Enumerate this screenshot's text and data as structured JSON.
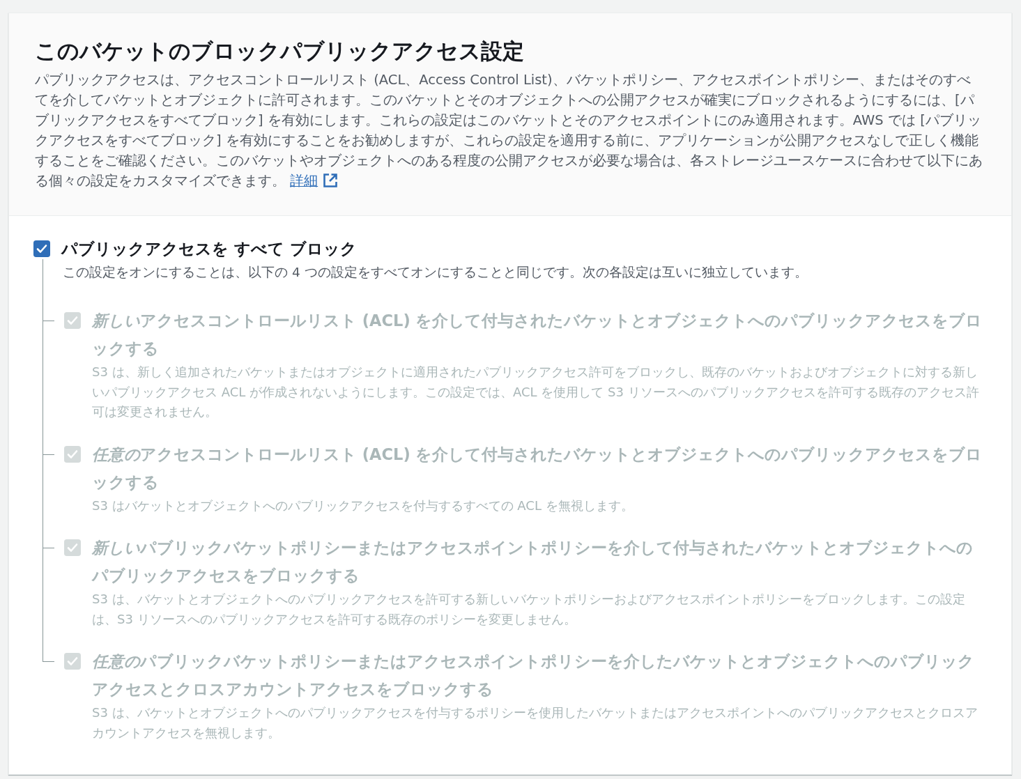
{
  "panel": {
    "title": "このバケットのブロックパブリックアクセス設定",
    "description": "パブリックアクセスは、アクセスコントロールリスト (ACL、Access Control List)、バケットポリシー、アクセスポイントポリシー、またはそのすべてを介してバケットとオブジェクトに許可されます。このバケットとそのオブジェクトへの公開アクセスが確実にブロックされるようにするには、[パブリックアクセスをすべてブロック] を有効にします。これらの設定はこのバケットとそのアクセスポイントにのみ適用されます。AWS では [パブリックアクセスをすべてブロック] を有効にすることをお勧めしますが、これらの設定を適用する前に、アプリケーションが公開アクセスなしで正しく機能することをご確認ください。このバケットやオブジェクトへのある程度の公開アクセスが必要な場合は、各ストレージユースケースに合わせて以下にある個々の設定をカスタマイズできます。",
    "link": {
      "label": "詳細"
    }
  },
  "block_all": {
    "label": "パブリックアクセスを すべて ブロック",
    "checked": true,
    "description": "この設定をオンにすることは、以下の 4 つの設定をすべてオンにすることと同じです。次の各設定は互いに独立しています。"
  },
  "options": [
    {
      "title": [
        {
          "text": "新しい",
          "italic": true
        },
        {
          "text": "アクセスコントロールリスト (ACL) を介して付与されたバケットとオブジェクトへのパブリックアクセスをブロックする",
          "italic": false
        }
      ],
      "description": "S3 は、新しく追加されたバケットまたはオブジェクトに適用されたパブリックアクセス許可をブロックし、既存のバケットおよびオブジェクトに対する新しいパブリックアクセス ACL が作成されないようにします。この設定では、ACL を使用して S3 リソースへのパブリックアクセスを許可する既存のアクセス許可は変更されません。",
      "checked": true,
      "disabled": true
    },
    {
      "title": [
        {
          "text": "任意の",
          "italic": true
        },
        {
          "text": "アクセスコントロールリスト (ACL) を介して付与されたバケットとオブジェクトへのパブリックアクセスをブロックする",
          "italic": false
        }
      ],
      "description": "S3 はバケットとオブジェクトへのパブリックアクセスを付与するすべての ACL を無視します。",
      "checked": true,
      "disabled": true
    },
    {
      "title": [
        {
          "text": "新しい",
          "italic": true
        },
        {
          "text": "パブリックバケットポリシーまたはアクセスポイントポリシーを介して付与されたバケットとオブジェクトへのパブリックアクセスをブロックする",
          "italic": false
        }
      ],
      "description": "S3 は、バケットとオブジェクトへのパブリックアクセスを許可する新しいバケットポリシーおよびアクセスポイントポリシーをブロックします。この設定は、S3 リソースへのパブリックアクセスを許可する既存のポリシーを変更しません。",
      "checked": true,
      "disabled": true
    },
    {
      "title": [
        {
          "text": "任意の",
          "italic": true
        },
        {
          "text": "パブリックバケットポリシーまたはアクセスポイントポリシーを介したバケットとオブジェクトへのパブリックアクセスとクロスアカウントアクセスをブロックする",
          "italic": false
        }
      ],
      "description": "S3 は、バケットとオブジェクトへのパブリックアクセスを付与するポリシーを使用したバケットまたはアクセスポイントへのパブリックアクセスとクロスアカウントアクセスを無視します。",
      "checked": true,
      "disabled": true
    }
  ]
}
